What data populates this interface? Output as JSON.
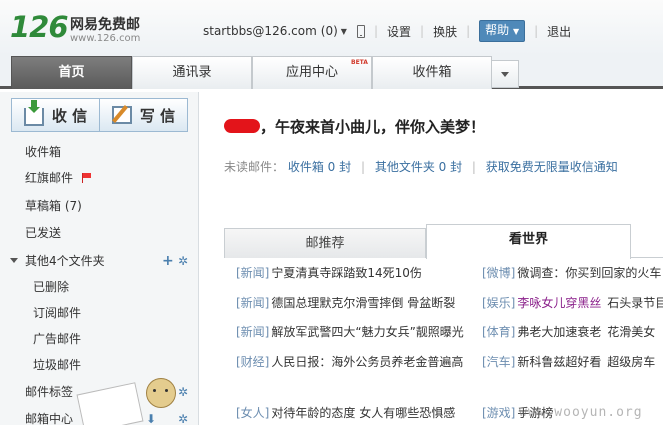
{
  "brand": {
    "logo_num": "126",
    "logo_name": "网易免费邮",
    "logo_url": "www.126.com"
  },
  "header": {
    "email": "startbbs@126.com",
    "count": "(0)",
    "links": [
      "设置",
      "换肤"
    ],
    "help": "帮助",
    "logout": "退出"
  },
  "tabs": {
    "home": "首页",
    "contacts": "通讯录",
    "apps": "应用中心",
    "apps_badge": "BETA",
    "inbox": "收件箱"
  },
  "sidebar": {
    "receive": "收 信",
    "compose": "写 信",
    "folders": [
      "收件箱",
      "红旗邮件",
      "草稿箱 (7)",
      "已发送",
      "其他4个文件夹"
    ],
    "subfolders": [
      "已删除",
      "订阅邮件",
      "广告邮件",
      "垃圾邮件"
    ],
    "tags": "邮件标签",
    "center": "邮箱中心"
  },
  "main": {
    "greeting": "，午夜来首小曲儿，伴你入美梦！",
    "unread_label": "未读邮件：",
    "unread_inbox": "收件箱 0 封",
    "unread_other": "其他文件夹 0 封",
    "promo": "获取免费无限量收信通知"
  },
  "news_tabs": [
    "邮推荐",
    "看世界"
  ],
  "news": [
    [
      {
        "cat": "[新闻]",
        "text": "宁夏清真寺踩踏致14死10伤"
      },
      {
        "cat": "[微博]",
        "text": "微调查：你买到回家的火车"
      }
    ],
    [
      {
        "cat": "[新闻]",
        "text": "德国总理默克尔滑雪摔倒 骨盆断裂"
      },
      {
        "cat": "[娱乐]",
        "text": "李咏女儿穿黑丝",
        "text2": "石头录节目"
      }
    ],
    [
      {
        "cat": "[新闻]",
        "text": "解放军武警四大“魅力女兵”靓照曝光"
      },
      {
        "cat": "[体育]",
        "text": "弗老大加速衰老",
        "text2": "花滑美女"
      }
    ],
    [
      {
        "cat": "[财经]",
        "text": "人民日报：海外公务员养老金普遍高"
      },
      {
        "cat": "[汽车]",
        "text": "新科鲁兹超好看",
        "text2": "超级房车"
      }
    ],
    [
      {
        "cat": "[女人]",
        "text": "对待年龄的态度 女人有哪些恐惧感"
      },
      {
        "cat": "[游戏]",
        "text": "手游榜"
      }
    ]
  ],
  "watermark": "www.wooyun.org",
  "colors": {
    "brand_green": "#2f8a3a",
    "link_blue": "#3a6fa0",
    "help_blue": "#4f89b9",
    "flag_red": "#e33"
  }
}
